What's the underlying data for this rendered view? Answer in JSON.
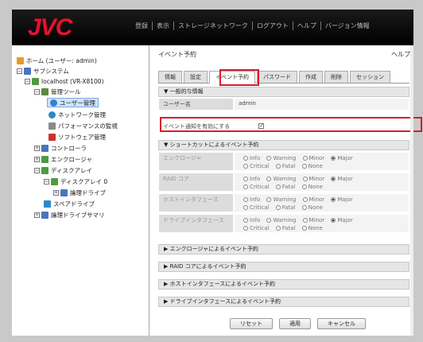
{
  "brand": {
    "logo": "JVC"
  },
  "menu": [
    "登録",
    "表示",
    "ストレージネットワーク",
    "ログアウト",
    "ヘルプ",
    "バージョン情報"
  ],
  "tree": [
    {
      "label": "ホーム (ユーザー: admin)",
      "icon": "home-icon"
    },
    {
      "label": "サブシステム",
      "icon": "subsystem-icon"
    },
    {
      "label": "localhost (VR-X8100)",
      "icon": "host-icon"
    },
    {
      "label": "管理ツール",
      "icon": "tools-icon"
    },
    {
      "label": "ユーザー管理",
      "icon": "user-icon"
    },
    {
      "label": "ネットワーク管理",
      "icon": "network-icon"
    },
    {
      "label": "パフォーマンスの監視",
      "icon": "chart-icon"
    },
    {
      "label": "ソフトウェア管理",
      "icon": "software-icon"
    },
    {
      "label": "コントローラ",
      "icon": "controller-icon"
    },
    {
      "label": "エンクロージャ",
      "icon": "enclosure-icon"
    },
    {
      "label": "ディスクアレイ",
      "icon": "disk-array-icon"
    },
    {
      "label": "ディスクアレイ 0",
      "icon": "disk-array-icon"
    },
    {
      "label": "論理ドライブ",
      "icon": "logical-drive-icon"
    },
    {
      "label": "スペアドライブ",
      "icon": "spare-drive-icon"
    },
    {
      "label": "論理ドライブサマリ",
      "icon": "logical-drive-icon"
    }
  ],
  "content": {
    "title": "イベント予約",
    "help": "ヘルプ",
    "tabs": [
      "情報",
      "設定",
      "イベント予約",
      "パスワード",
      "作成",
      "削除",
      "セッション"
    ],
    "general": {
      "header": "一般的な情報",
      "username_label": "ユーザー名",
      "username_value": "admin",
      "notify_label": "イベント通知を有効にする",
      "notify_checked": true
    },
    "shortcut": {
      "header": "ショートカットによるイベント予約",
      "rows": [
        "エンクロージャ",
        "RAID コア",
        "ホストインタフェース",
        "ドライブインタフェース"
      ],
      "options": [
        "Info",
        "Warning",
        "Minor",
        "Major",
        "Critical",
        "Fatal",
        "None"
      ],
      "selected": "Major"
    },
    "collapsed": [
      "エンクロージャによるイベント予約",
      "RAID コアによるイベント予約",
      "ホストインタフェースによるイベント予約",
      "ドライブインタフェースによるイベント予約"
    ],
    "buttons": [
      "リセット",
      "適用",
      "キャンセル"
    ]
  },
  "colors": {
    "accent": "#d81b2b",
    "logo": "#e8112d"
  }
}
